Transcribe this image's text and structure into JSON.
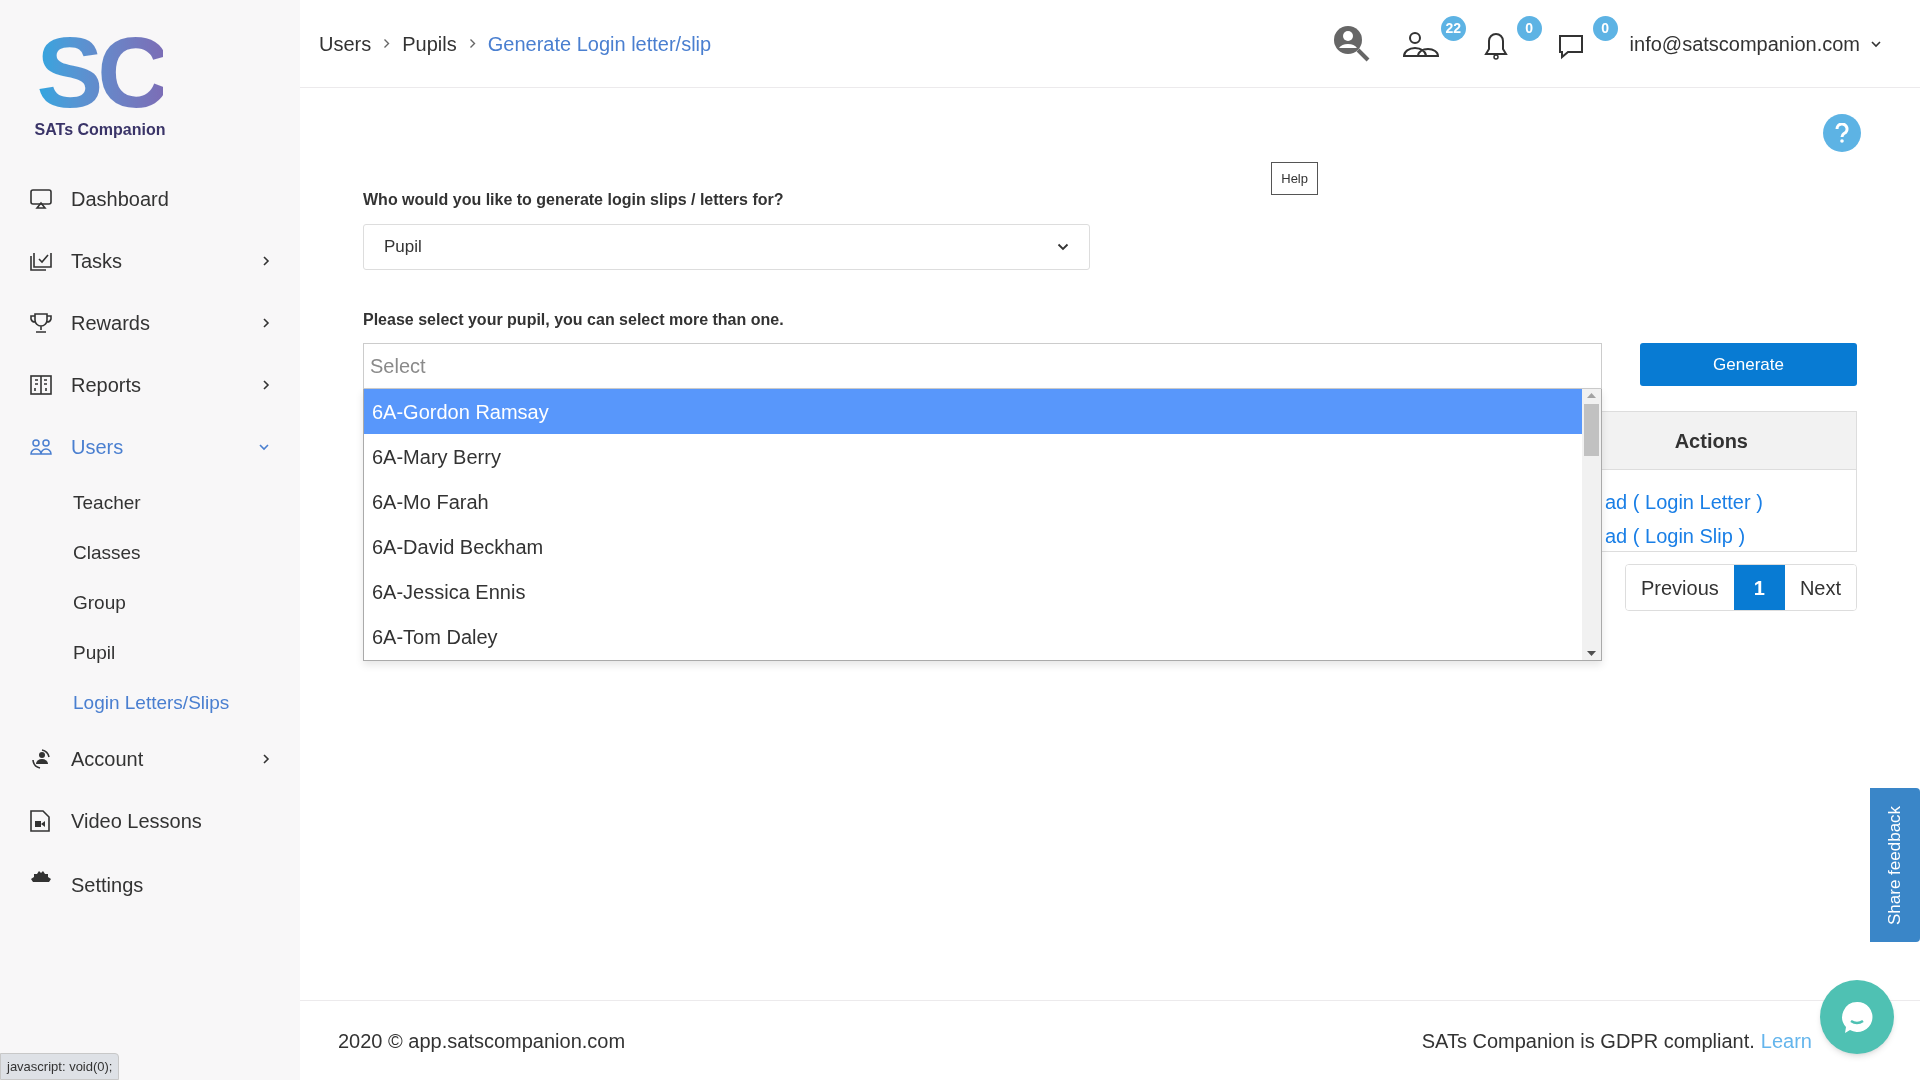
{
  "logo": {
    "mark": "SC",
    "name": "SATs Companion"
  },
  "sidebar": {
    "items": [
      {
        "kind": "link",
        "label": "Dashboard",
        "selected": false
      },
      {
        "kind": "group",
        "label": "Tasks",
        "selected": false,
        "expanded": false
      },
      {
        "kind": "group",
        "label": "Rewards",
        "selected": false,
        "expanded": false
      },
      {
        "kind": "group",
        "label": "Reports",
        "selected": false,
        "expanded": false
      },
      {
        "kind": "group",
        "label": "Users",
        "selected": true,
        "expanded": true,
        "children": [
          {
            "label": "Teacher",
            "selected": false
          },
          {
            "label": "Classes",
            "selected": false
          },
          {
            "label": "Group",
            "selected": false
          },
          {
            "label": "Pupil",
            "selected": false
          },
          {
            "label": "Login Letters/Slips",
            "selected": true
          }
        ]
      },
      {
        "kind": "group",
        "label": "Account",
        "selected": false,
        "expanded": false
      },
      {
        "kind": "link",
        "label": "Video Lessons",
        "selected": false
      },
      {
        "kind": "link",
        "label": "Settings",
        "selected": false
      }
    ]
  },
  "breadcrumb": [
    {
      "label": "Users",
      "current": false
    },
    {
      "label": "Pupils",
      "current": false
    },
    {
      "label": "Generate Login letter/slip",
      "current": true
    }
  ],
  "header": {
    "badges": [
      "22",
      "0",
      "0"
    ],
    "account": "info@satscompanion.com"
  },
  "help_button": "Help",
  "form": {
    "recipient_label": "Who would you like to generate login slips / letters for?",
    "recipient_value": "Pupil",
    "pupil_label": "Please select your pupil, you can select more than one.",
    "pupil_placeholder": "Select",
    "options": [
      {
        "label": "6A-Gordon Ramsay",
        "selected": true
      },
      {
        "label": "6A-Mary Berry",
        "selected": false
      },
      {
        "label": "6A-Mo Farah",
        "selected": false
      },
      {
        "label": "6A-David Beckham",
        "selected": false
      },
      {
        "label": "6A-Jessica Ennis",
        "selected": false
      },
      {
        "label": "6A-Tom Daley",
        "selected": false
      }
    ],
    "generate": "Generate"
  },
  "table": {
    "columns": [
      "Actions"
    ],
    "links": [
      "ad ( Login Letter )",
      "ad ( Login Slip )"
    ]
  },
  "pagination": [
    {
      "label": "Previous",
      "selected": false
    },
    {
      "label": "1",
      "selected": true
    },
    {
      "label": "Next",
      "selected": false
    }
  ],
  "footer": {
    "copyright": "2020 © app.satscompanion.com",
    "gdpr": "SATs Companion is GDPR compliant.",
    "link": "Learn"
  },
  "feedback_tab": "Share feedback",
  "status_tooltip": "javascript: void(0);"
}
